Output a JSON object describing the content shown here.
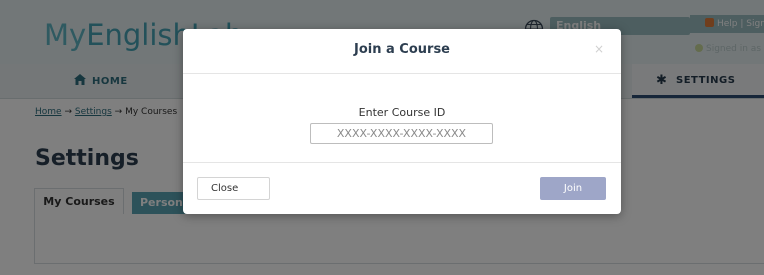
{
  "header": {
    "logo_prefix": "My",
    "logo_main": "EnglishLab",
    "language": "English",
    "help_links": "Help | Sign out",
    "signed_in": "Signed in as Y..."
  },
  "nav": {
    "home_label": "HOME",
    "settings_label": "SETTINGS"
  },
  "breadcrumb": {
    "home": "Home",
    "sep1": "→",
    "settings": "Settings",
    "sep2": "→",
    "current": "My Courses"
  },
  "page": {
    "title": "Settings",
    "tabs": [
      "My Courses",
      "Personal"
    ]
  },
  "modal": {
    "title": "Join a Course",
    "close_x": "×",
    "field_label": "Enter Course ID",
    "input_placeholder": "XXXX-XXXX-XXXX-XXXX",
    "input_value": "",
    "close_button": "Close",
    "join_button": "Join"
  },
  "colors": {
    "accent": "#47a3b4",
    "nav_active": "#2c4c73",
    "join_button": "#9ea6c8"
  }
}
